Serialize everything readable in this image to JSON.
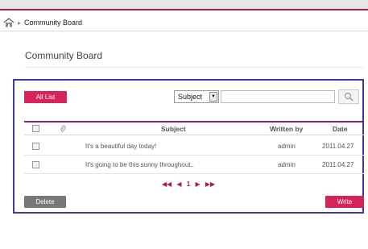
{
  "breadcrumb": {
    "current": "Community Board"
  },
  "page": {
    "title": "Community Board"
  },
  "toolbar": {
    "all_list_label": "All List",
    "search_field_selected": "Subject",
    "search_value": ""
  },
  "table": {
    "headers": {
      "subject": "Subject",
      "written_by": "Written by",
      "date": "Date"
    },
    "rows": [
      {
        "subject": "It's a beautiful day today!",
        "written_by": "admin",
        "date": "2011.04.27"
      },
      {
        "subject": "It's going to be this sunny throughout..",
        "written_by": "admin",
        "date": "2011.04.27"
      }
    ]
  },
  "pagination": {
    "current_page": "1"
  },
  "actions": {
    "delete_label": "Delete",
    "write_label": "Write"
  },
  "colors": {
    "accent": "#d6245b",
    "border": "#3e3a9e",
    "header_rule": "#7b2a6e"
  }
}
